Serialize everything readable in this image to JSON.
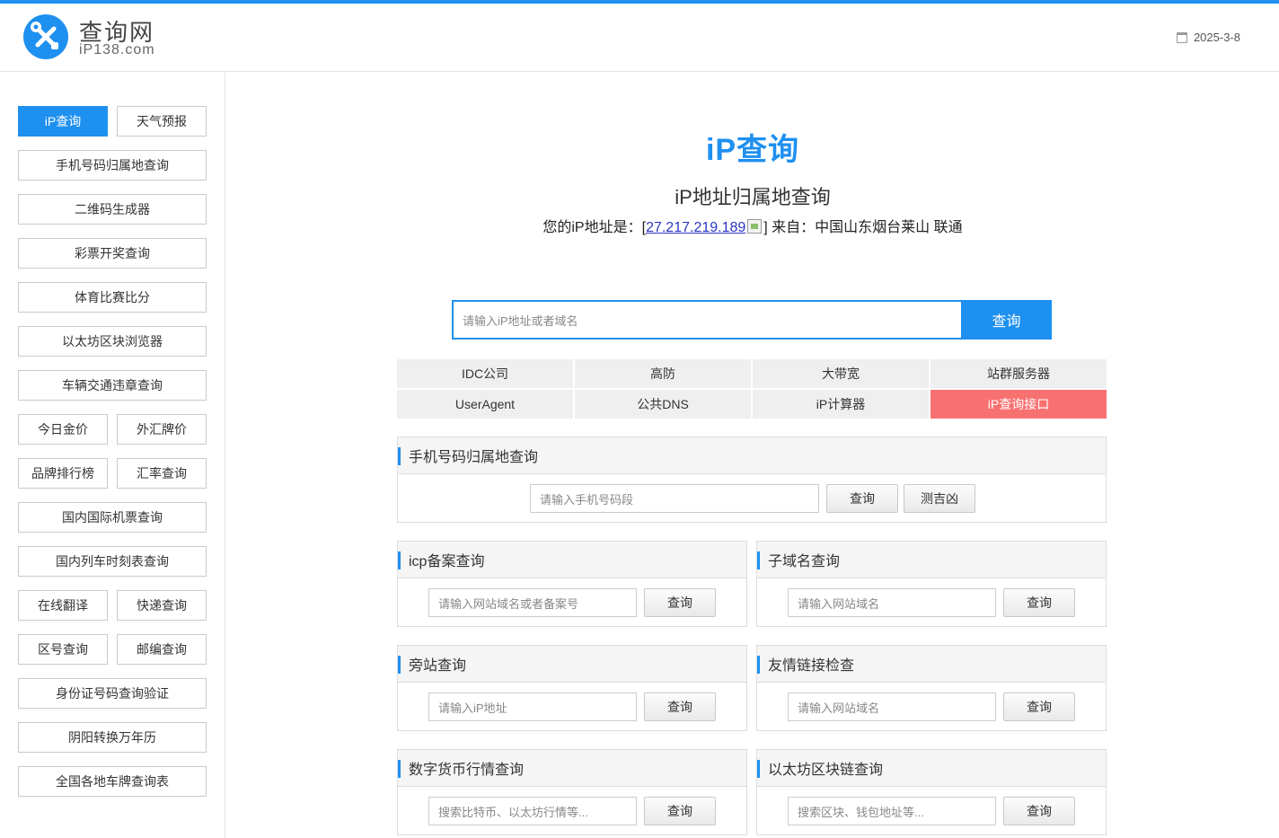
{
  "header": {
    "logo_name": "查询网",
    "logo_domain": "iP138.com",
    "date": "2025-3-8"
  },
  "sidebar": {
    "items": [
      {
        "label": "iP查询",
        "active": true
      },
      {
        "label": "天气预报"
      },
      {
        "label": "手机号码归属地查询"
      },
      {
        "label": "二维码生成器"
      },
      {
        "label": "彩票开奖查询"
      },
      {
        "label": "体育比赛比分"
      },
      {
        "label": "以太坊区块浏览器"
      },
      {
        "label": "车辆交通违章查询"
      },
      {
        "label": "今日金价"
      },
      {
        "label": "外汇牌价"
      },
      {
        "label": "品牌排行榜"
      },
      {
        "label": "汇率查询"
      },
      {
        "label": "国内国际机票查询"
      },
      {
        "label": "国内列车时刻表查询"
      },
      {
        "label": "在线翻译"
      },
      {
        "label": "快递查询"
      },
      {
        "label": "区号查询"
      },
      {
        "label": "邮编查询"
      },
      {
        "label": "身份证号码查询验证"
      },
      {
        "label": "阴阳转换万年历"
      },
      {
        "label": "全国各地车牌查询表"
      }
    ]
  },
  "main": {
    "title": "iP查询",
    "subtitle": "iP地址归属地查询",
    "ip_prefix": "您的iP地址是：[",
    "ip_address": "27.217.219.189",
    "ip_suffix": "] 来自：中国山东烟台莱山 联通",
    "search": {
      "placeholder": "请输入iP地址或者域名",
      "button": "查询"
    },
    "links": [
      {
        "label": "IDC公司"
      },
      {
        "label": "高防"
      },
      {
        "label": "大带宽"
      },
      {
        "label": "站群服务器"
      },
      {
        "label": "UserAgent"
      },
      {
        "label": "公共DNS"
      },
      {
        "label": "iP计算器"
      },
      {
        "label": "iP查询接口",
        "highlight": true,
        "color": "#f87171"
      }
    ],
    "phone_panel": {
      "title": "手机号码归属地查询",
      "placeholder": "请输入手机号码段",
      "button": "查询",
      "button2": "测吉凶"
    },
    "panels": [
      {
        "title": "icp备案查询",
        "placeholder": "请输入网站域名或者备案号",
        "button": "查询"
      },
      {
        "title": "子域名查询",
        "placeholder": "请输入网站域名",
        "button": "查询"
      },
      {
        "title": "旁站查询",
        "placeholder": "请输入iP地址",
        "button": "查询"
      },
      {
        "title": "友情链接检查",
        "placeholder": "请输入网站域名",
        "button": "查询"
      },
      {
        "title": "数字货币行情查询",
        "placeholder": "搜索比特币、以太坊行情等...",
        "button": "查询"
      },
      {
        "title": "以太坊区块链查询",
        "placeholder": "搜索区块、钱包地址等...",
        "button": "查询"
      }
    ]
  },
  "colors": {
    "accent": "#1e90f0",
    "highlight": "#f87171"
  }
}
